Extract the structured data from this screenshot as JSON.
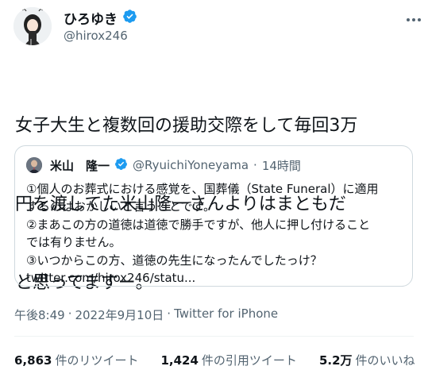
{
  "colors": {
    "verified": "#1d9bf0",
    "text": "#0f1419",
    "muted": "#536471",
    "border": "#cfd9de"
  },
  "author": {
    "display_name": "ひろゆき",
    "handle": "@hirox246",
    "avatar_icon": "avatar-illustration",
    "verified_icon": "verified-badge-icon"
  },
  "tweet": {
    "lines": [
      "女子大生と複数回の援助交際をして毎回3万",
      "円を渡してた米山隆一さんよりはまともだ",
      "と思ってますー。"
    ]
  },
  "quoted": {
    "display_name": "米山　隆一",
    "handle": "@RyuichiYoneyama",
    "separator": "·",
    "time": "14時間",
    "lines": [
      "①個人のお葬式における感覚を、国葬儀（State Funeral）に適用",
      "するのはおかしいと言うことです。",
      "②まあこの方の道徳は道徳で勝手ですが、他人に押し付けること",
      "では有りません。",
      "③いつからこの方、道徳の先生になったんでしたっけ？",
      "twitter.com/hirox246/statu..."
    ]
  },
  "meta": {
    "time": "午後8:49",
    "separator1": "·",
    "date": "2022年9月10日",
    "separator2": "·",
    "source": "Twitter for iPhone"
  },
  "stats": [
    {
      "count": "6,863",
      "label": "件のリツイート"
    },
    {
      "count": "1,424",
      "label": "件の引用ツイート"
    },
    {
      "count": "5.2万",
      "label": "件のいいね"
    }
  ]
}
